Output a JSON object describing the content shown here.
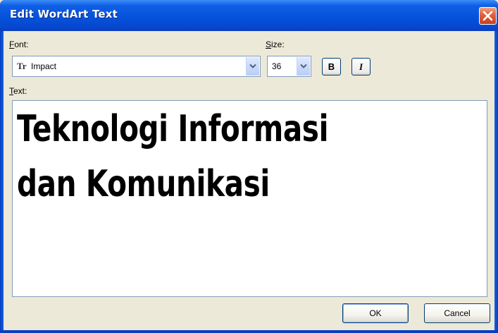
{
  "window": {
    "title": "Edit WordArt Text"
  },
  "font": {
    "label_accel": "F",
    "label_rest": "ont:",
    "value": "Impact",
    "glyph": "Tr"
  },
  "size": {
    "label_accel": "S",
    "label_rest": "ize:",
    "value": "36"
  },
  "format": {
    "bold": "B",
    "italic": "I"
  },
  "text": {
    "label_accel": "T",
    "label_rest": "ext:",
    "lines": [
      "Teknologi Informasi",
      "dan Komunikasi"
    ]
  },
  "buttons": {
    "ok": "OK",
    "cancel": "Cancel"
  },
  "icons": {
    "close": "close-icon",
    "dropdown": "chevron-down-icon",
    "font_type": "truetype-font-icon"
  },
  "colors": {
    "titlebar": "#0653db",
    "client": "#ece9d8",
    "close": "#e0603a",
    "field_border": "#7f9db9"
  }
}
